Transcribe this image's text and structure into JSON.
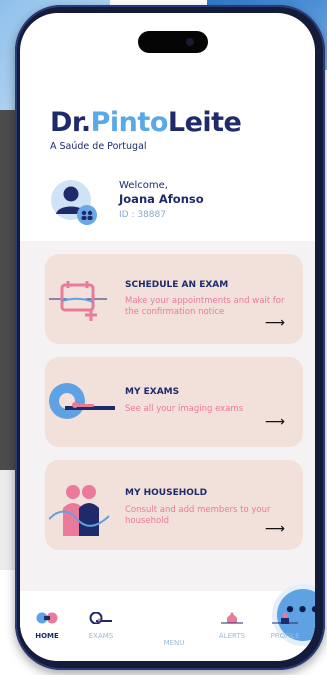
{
  "brand": {
    "name_part1": "Dr.",
    "name_part2": "Pinto",
    "name_part3": "Leite",
    "tagline": "A Saúde de Portugal"
  },
  "user": {
    "welcome": "Welcome,",
    "name": "Joana Afonso",
    "id": "ID : 38887"
  },
  "cards": [
    {
      "title": "SCHEDULE AN EXAM",
      "description": "Make your appointments and wait for the confirmation notice",
      "arrow": "⟶"
    },
    {
      "title": "MY EXAMS",
      "description": "See all your imaging exams",
      "arrow": "⟶"
    },
    {
      "title": "MY HOUSEHOLD",
      "description": "Consult and add members to your household",
      "arrow": "⟶"
    }
  ],
  "nav": {
    "home": "HOME",
    "exams": "EXAMS",
    "menu": "MENU",
    "alerts": "ALERTS",
    "profile": "PROFILE",
    "menu_dots": "•••"
  },
  "colors": {
    "navy": "#1f2a6b",
    "accent_blue": "#5fa2e3",
    "pink": "#ea7a9c",
    "card_bg": "#f1e1da"
  }
}
